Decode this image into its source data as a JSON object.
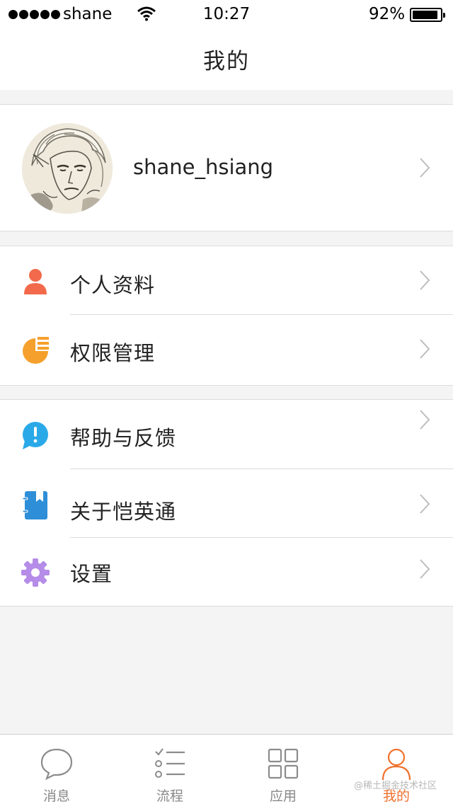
{
  "status_bar": {
    "carrier": "shane",
    "time": "10:27",
    "battery": "92%"
  },
  "nav": {
    "title": "我的"
  },
  "profile": {
    "username": "shane_hsiang"
  },
  "menu_group_1": [
    {
      "label": "个人资料",
      "icon": "person-icon",
      "color": "#f26a4b"
    },
    {
      "label": "权限管理",
      "icon": "pie-chart-icon",
      "color": "#f5a02c"
    }
  ],
  "menu_group_2": [
    {
      "label": "帮助与反馈",
      "icon": "help-bubble-icon",
      "color": "#2aa9e8"
    },
    {
      "label": "关于恺英通",
      "icon": "notebook-icon",
      "color": "#2e8fd8"
    },
    {
      "label": "设置",
      "icon": "gear-icon",
      "color": "#b58ce8"
    }
  ],
  "tab_bar": {
    "tabs": [
      {
        "label": "消息",
        "icon": "chat-bubble-icon"
      },
      {
        "label": "流程",
        "icon": "checklist-icon"
      },
      {
        "label": "应用",
        "icon": "grid-apps-icon"
      },
      {
        "label": "我的",
        "icon": "user-icon"
      }
    ],
    "active_color": "#f0712c"
  },
  "watermark": "@稀土掘金技术社区"
}
